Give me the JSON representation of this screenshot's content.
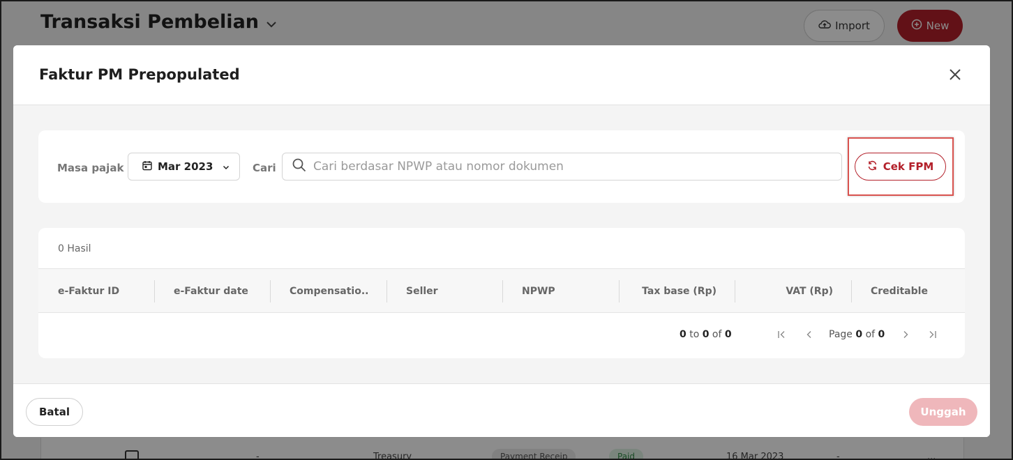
{
  "background": {
    "title": "Transaksi Pembelian",
    "import_label": "Import",
    "new_label": "New",
    "row": {
      "dash1": "-",
      "source": "Treasury",
      "type": "Payment Receip",
      "status": "Paid",
      "date": "16 Mar 2023",
      "dash2": "-",
      "more": "..."
    }
  },
  "modal": {
    "title": "Faktur PM Prepopulated",
    "filter": {
      "period_label": "Masa pajak",
      "period_value": "Mar 2023",
      "search_label": "Cari",
      "search_placeholder": "Cari berdasar NPWP atau nomor dokumen",
      "search_value": "",
      "check_button": "Cek FPM"
    },
    "table": {
      "results_text": "0 Hasil",
      "columns": [
        "e-Faktur ID",
        "e-Faktur date",
        "Compensatio...",
        "Seller",
        "NPWP",
        "Tax base (Rp)",
        "VAT (Rp)",
        "Creditable"
      ],
      "rows": [],
      "pager": {
        "from": "0",
        "to_word": "to",
        "to": "0",
        "of_word": "of",
        "total": "0",
        "page_word": "Page",
        "page": "0",
        "page_of_word": "of",
        "pages": "0"
      }
    },
    "footer": {
      "cancel_label": "Batal",
      "upload_label": "Unggah"
    }
  },
  "colors": {
    "accent": "#b3202a",
    "accent_disabled": "#efb7bb",
    "highlight_box": "#d9534f"
  }
}
